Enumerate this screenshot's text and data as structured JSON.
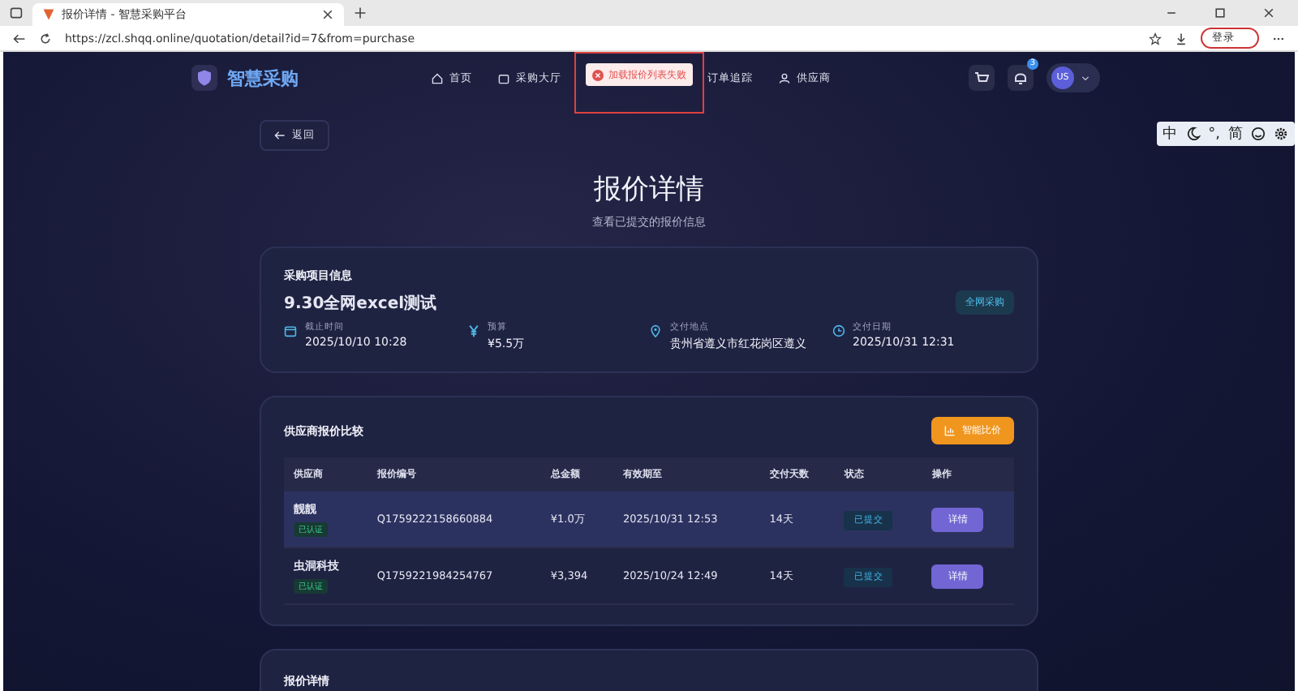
{
  "browser": {
    "tab_title": "报价详情 - 智慧采购平台",
    "url": "https://zcl.shqq.online/quotation/detail?id=7&from=purchase",
    "login_button": "登录"
  },
  "nav": {
    "brand": "智慧采购",
    "items": [
      {
        "label": "首页"
      },
      {
        "label": "采购大厅"
      },
      {
        "label": "订单追踪"
      },
      {
        "label": "供应商"
      }
    ],
    "notification_count": "3",
    "avatar": "US"
  },
  "toast": {
    "message": "加载报价列表失败"
  },
  "ime_toolbar": {
    "items": [
      "中",
      "°,",
      "简"
    ]
  },
  "back_button": "返回",
  "header": {
    "title": "报价详情",
    "subtitle": "查看已提交的报价信息"
  },
  "project": {
    "section_title": "采购项目信息",
    "name": "9.30全网excel测试",
    "tag": "全网采购",
    "fields": [
      {
        "label": "截止时间",
        "value": "2025/10/10 10:28"
      },
      {
        "label": "预算",
        "value": "¥5.5万"
      },
      {
        "label": "交付地点",
        "value": "贵州省遵义市红花岗区遵义"
      },
      {
        "label": "交付日期",
        "value": "2025/10/31 12:31"
      }
    ]
  },
  "comparison": {
    "title": "供应商报价比较",
    "smart_button": "智能比价",
    "columns": [
      "供应商",
      "报价编号",
      "总金额",
      "有效期至",
      "交付天数",
      "状态",
      "操作"
    ],
    "rows": [
      {
        "supplier": "靓靓",
        "badge": "已认证",
        "quote_no": "Q1759222158660884",
        "amount": "¥1.0万",
        "valid_until": "2025/10/31 12:53",
        "days": "14天",
        "status": "已提交",
        "action": "详情",
        "selected": true
      },
      {
        "supplier": "虫洞科技",
        "badge": "已认证",
        "quote_no": "Q1759221984254767",
        "amount": "¥3,394",
        "valid_until": "2025/10/24 12:49",
        "days": "14天",
        "status": "已提交",
        "action": "详情",
        "selected": false
      }
    ]
  },
  "detail_card": {
    "title": "报价详情"
  }
}
